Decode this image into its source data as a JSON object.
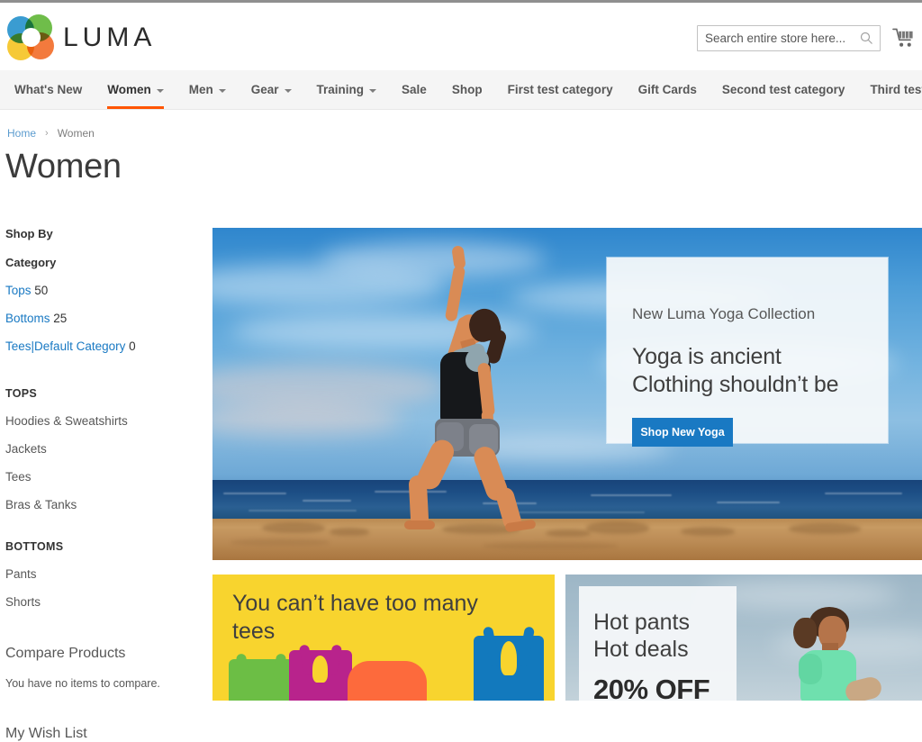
{
  "header": {
    "logo_text": "LUMA",
    "logo_icon": "luma-flower-logo",
    "search": {
      "placeholder": "Search entire store here...",
      "value": "",
      "icon": "search-icon"
    },
    "cart_icon": "shopping-cart-icon"
  },
  "nav": {
    "items": [
      {
        "label": "What's New",
        "has_caret": false,
        "active": false
      },
      {
        "label": "Women",
        "has_caret": true,
        "active": true
      },
      {
        "label": "Men",
        "has_caret": true,
        "active": false
      },
      {
        "label": "Gear",
        "has_caret": true,
        "active": false
      },
      {
        "label": "Training",
        "has_caret": true,
        "active": false
      },
      {
        "label": "Sale",
        "has_caret": false,
        "active": false
      },
      {
        "label": "Shop",
        "has_caret": false,
        "active": false
      },
      {
        "label": "First test category",
        "has_caret": false,
        "active": false
      },
      {
        "label": "Gift Cards",
        "has_caret": false,
        "active": false
      },
      {
        "label": "Second test category",
        "has_caret": false,
        "active": false
      },
      {
        "label": "Third test category",
        "has_caret": false,
        "active": false
      }
    ],
    "active_accent_color": "#ff5501"
  },
  "breadcrumb": {
    "home": "Home",
    "separator": "›",
    "current": "Women"
  },
  "page": {
    "title": "Women"
  },
  "sidebar": {
    "shop_by_title": "Shop By",
    "category_title": "Category",
    "filters": [
      {
        "label": "Tops",
        "count": "50"
      },
      {
        "label": "Bottoms",
        "count": "25"
      },
      {
        "label": "Tees",
        "label2": "Default Category",
        "separator": "|",
        "count": "0"
      }
    ],
    "groups": [
      {
        "heading": "TOPS",
        "links": [
          "Hoodies & Sweatshirts",
          "Jackets",
          "Tees",
          "Bras & Tanks"
        ]
      },
      {
        "heading": "BOTTOMS",
        "links": [
          "Pants",
          "Shorts"
        ]
      }
    ],
    "compare": {
      "title": "Compare Products",
      "empty_text": "You have no items to compare."
    },
    "wishlist": {
      "title": "My Wish List"
    },
    "link_color": "#1979c3"
  },
  "hero": {
    "eyebrow": "New Luma Yoga Collection",
    "headline_line1": "Yoga is ancient",
    "headline_line2": "Clothing shouldn’t be",
    "cta_label": "Shop New Yoga",
    "cta_color": "#1979c3",
    "scene": "woman-doing-yoga-warrior-pose-on-beach"
  },
  "promos": [
    {
      "id": "tees-promo",
      "text": "You can’t have too many tees",
      "background_color": "#f8d42e",
      "graphic": "colored-tank-top-silhouettes"
    },
    {
      "id": "hot-pants-promo",
      "line1": "Hot pants",
      "line2": "Hot deals",
      "discount": "20% OFF",
      "graphic": "woman-runner-outdoors"
    }
  ]
}
